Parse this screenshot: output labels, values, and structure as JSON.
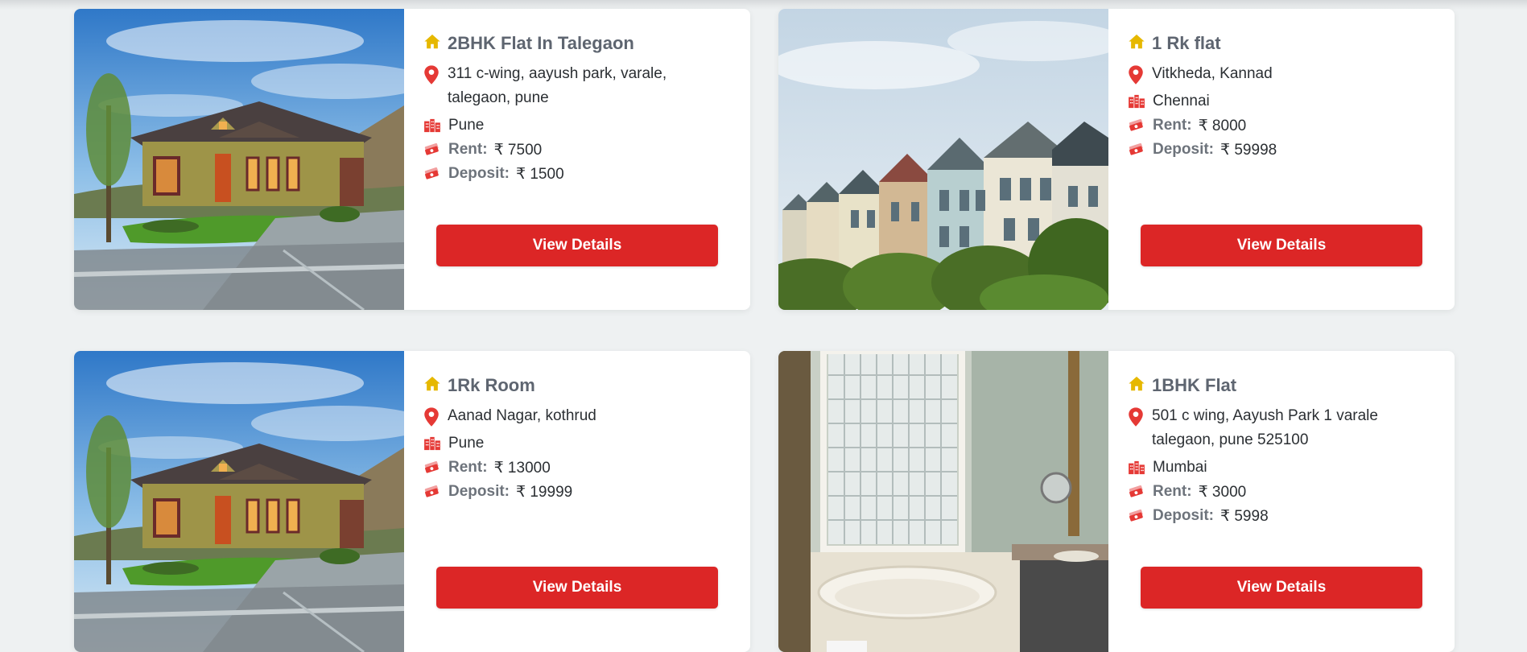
{
  "listings": [
    {
      "title": "2BHK Flat In Talegaon",
      "address_line1": "311 c-wing, aayush park, varale,",
      "address_line2": "talegaon, pune",
      "city": "Pune",
      "rent_label": "Rent:",
      "rent_value": "₹ 7500",
      "deposit_label": "Deposit:",
      "deposit_value": "₹ 1500",
      "button_label": "View Details",
      "image": "house-exterior-photo"
    },
    {
      "title": "1 Rk flat",
      "address_line1": "Vitkheda, Kannad",
      "address_line2": "",
      "city": "Chennai",
      "rent_label": "Rent:",
      "rent_value": "₹ 8000",
      "deposit_label": "Deposit:",
      "deposit_value": "₹ 59998",
      "button_label": "View Details",
      "image": "row-houses-photo"
    },
    {
      "title": "1Rk Room",
      "address_line1": "Aanad Nagar, kothrud",
      "address_line2": "",
      "city": "Pune",
      "rent_label": "Rent:",
      "rent_value": "₹ 13000",
      "deposit_label": "Deposit:",
      "deposit_value": "₹ 19999",
      "button_label": "View Details",
      "image": "house-exterior-photo"
    },
    {
      "title": "1BHK Flat",
      "address_line1": "501 c wing, Aayush Park 1 varale",
      "address_line2": "talegaon, pune 525100",
      "city": "Mumbai",
      "rent_label": "Rent:",
      "rent_value": "₹ 3000",
      "deposit_label": "Deposit:",
      "deposit_value": "₹ 5998",
      "button_label": "View Details",
      "image": "bathroom-photo"
    }
  ],
  "icons": {
    "title": "home-icon",
    "address": "map-pin-icon",
    "city": "city-buildings-icon",
    "money": "money-bills-icon"
  },
  "colors": {
    "page_bg": "#eef1f2",
    "button": "#dc2626",
    "home_icon": "#e6b800",
    "accent_icon": "#e53935"
  }
}
